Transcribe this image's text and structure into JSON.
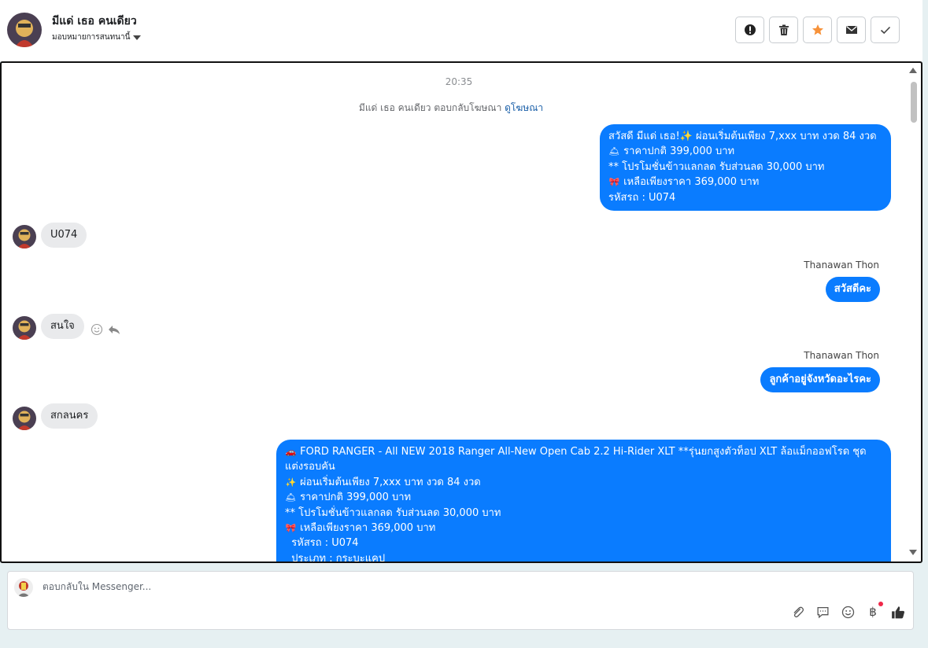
{
  "header": {
    "contact_name": "มีแด่ เธอ คนเดียว",
    "assign_label": "มอบหมายการสนทนานี้"
  },
  "toolbar": {
    "icons": [
      "alert-icon",
      "trash-icon",
      "star-icon",
      "envelope-icon",
      "check-icon"
    ],
    "accent_star": "#f7923a"
  },
  "chat": {
    "timestamp": "20:35",
    "ad_reply_text": "มีแด่ เธอ คนเดียว ตอบกลับโฆษณา",
    "ad_reply_link": "ดูโฆษณา",
    "messages": [
      {
        "side": "out",
        "lines": [
          {
            "emoji": "",
            "text": "สวัสดี มีแด่ เธอ!✨  ผ่อนเริ่มต้นเพียง 7,xxx บาท งวด 84 งวด"
          },
          {
            "emoji": "🛎",
            "text": "ราคาปกติ 399,000 บาท"
          },
          {
            "emoji": "",
            "text": "** โปรโมชั่นข้าวแลกลด รับส่วนลด 30,000 บาท"
          },
          {
            "emoji": "🎀",
            "text": "เหลือเพียงราคา 369,000 บาท"
          },
          {
            "emoji": "",
            "text": " รหัสรถ : U074"
          }
        ]
      },
      {
        "side": "in",
        "text": "U074"
      },
      {
        "side": "out",
        "sender": "Thanawan Thon",
        "text": "สวัสดีคะ"
      },
      {
        "side": "in",
        "text": "สนใจ"
      },
      {
        "side": "out",
        "sender": "Thanawan Thon",
        "text": "ลูกค้าอยู่จังหวัดอะไรคะ"
      },
      {
        "side": "in",
        "text": "สกลนคร"
      },
      {
        "side": "out",
        "lines": [
          {
            "emoji": "🚗",
            "text": "FORD RANGER - All NEW 2018 Ranger All-New Open Cab 2.2 Hi-Rider XLT **รุ่นยกสูงตัวท็อป XLT ล้อแม็กออฟโรด ชุด"
          },
          {
            "emoji": "",
            "text": "แต่งรอบคัน"
          },
          {
            "emoji": "✨",
            "text": "ผ่อนเริ่มต้นเพียง 7,xxx บาท งวด 84 งวด"
          },
          {
            "emoji": "🛎",
            "text": "ราคาปกติ 399,000 บาท"
          },
          {
            "emoji": "",
            "text": "** โปรโมชั่นข้าวแลกลด รับส่วนลด 30,000 บาท"
          },
          {
            "emoji": "🎀",
            "text": "เหลือเพียงราคา 369,000 บาท"
          },
          {
            "emoji": "",
            "text": "  รหัสรถ : U074"
          },
          {
            "emoji": "",
            "text": "  ประเภท : กระบะแคป"
          }
        ]
      }
    ]
  },
  "composer": {
    "placeholder": "ตอบกลับใน Messenger...",
    "icons": [
      "paperclip-icon",
      "chat-bubble-icon",
      "smiley-icon",
      "baht-icon",
      "thumbs-up-icon"
    ],
    "baht_symbol": "฿"
  },
  "colors": {
    "bubble_out": "#0a7cff",
    "bubble_in": "#e9eaec",
    "page_bg": "#e6f0f2"
  }
}
